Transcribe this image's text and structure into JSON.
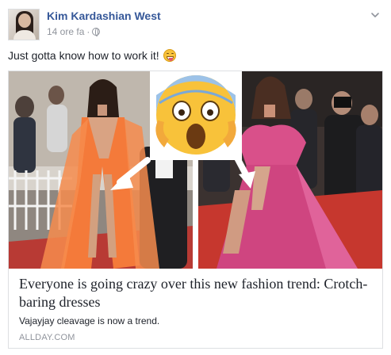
{
  "post": {
    "author": "Kim Kardashian West",
    "timestamp": "14 ore fa",
    "separator": "·",
    "privacy_icon": "globe-icon",
    "menu_icon": "chevron-down-icon",
    "message": "Just gotta know how to work it!",
    "message_emoji": "grinning-tongue-emoji"
  },
  "link_card": {
    "image_description_icons": [
      "screaming-emoji",
      "arrow-icon"
    ],
    "headline": "Everyone is going crazy over this new fashion trend: Crotch-baring dresses",
    "description": "Vajayjay cleavage is now a trend.",
    "domain": "ALLDAY.COM"
  },
  "colors": {
    "author_link": "#365899",
    "meta_text": "#90949c",
    "body_text": "#1d2129",
    "card_border": "#dddfe2",
    "orange_dress": "#f47a3a",
    "pink_dress": "#d9508a",
    "red_carpet": "#c6372e"
  }
}
